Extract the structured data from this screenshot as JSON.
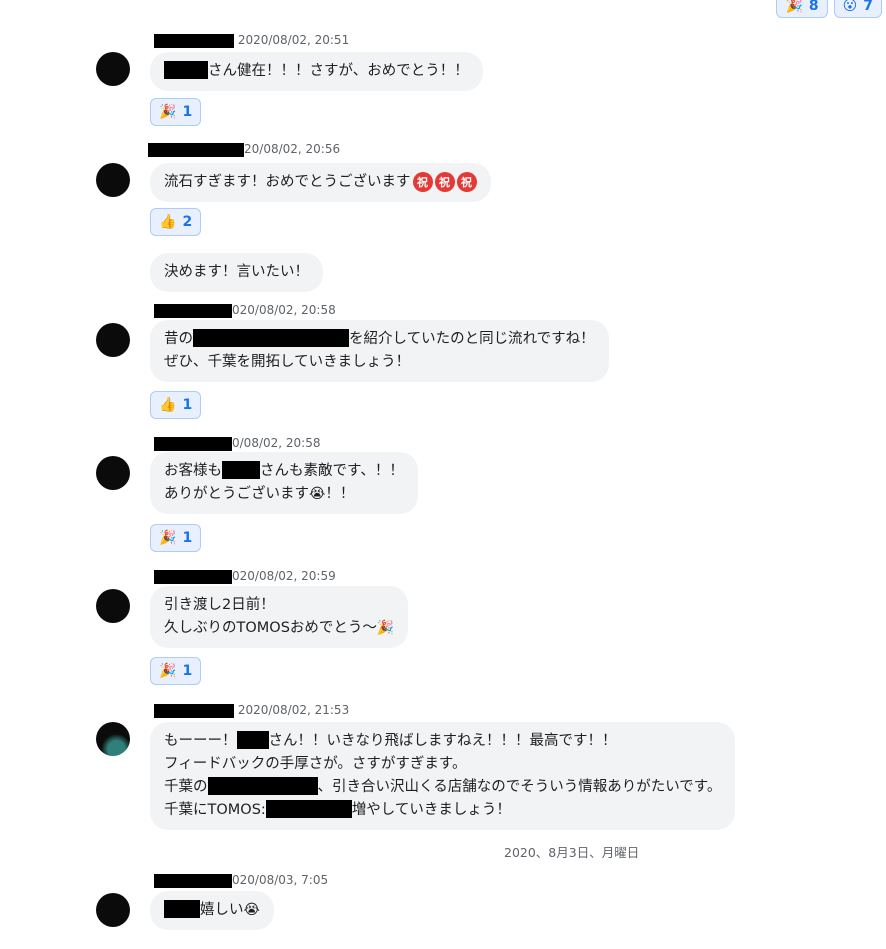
{
  "top_reactions": [
    {
      "emoji": "🎉",
      "count": "8"
    },
    {
      "emoji": "😮",
      "count": "7"
    }
  ],
  "messages": [
    {
      "timestamp": "2020/08/02, 20:51",
      "lines": [
        "さん健在！！！さすが、おめでとう！！"
      ],
      "reaction": {
        "emoji": "🎉",
        "count": "1"
      }
    },
    {
      "timestamp": "20/08/02, 20:56",
      "lines": [
        "流石すぎます！おめでとうございます"
      ],
      "badge": "祝",
      "reaction": {
        "emoji": "👍",
        "count": "2"
      },
      "followup": "決めます！言いたい！"
    },
    {
      "timestamp": "020/08/02, 20:58",
      "lines": [
        "昔の",
        "を紹介していたのと同じ流れですね！",
        "ぜひ、千葉を開拓していきましょう！"
      ],
      "reaction": {
        "emoji": "👍",
        "count": "1"
      }
    },
    {
      "timestamp": "0/08/02, 20:58",
      "lines": [
        "お客様も",
        "さんも素敵です、！！",
        "ありがとうございます",
        "！！"
      ],
      "reaction": {
        "emoji": "🎉",
        "count": "1"
      }
    },
    {
      "timestamp": "020/08/02, 20:59",
      "lines": [
        "引き渡し2日前！",
        "久しぶりのTOMOSおめでとう〜"
      ],
      "reaction": {
        "emoji": "🎉",
        "count": "1"
      }
    },
    {
      "timestamp": "2020/08/02, 21:53",
      "lines": [
        "もーーー！",
        "さん！！いきなり飛ばしますねえ！！！最高です！！",
        "フィードバックの手厚さが。さすがすぎます。",
        "千葉の",
        "、引き合い沢山くる店舗なのでそういう情報ありがたいです。",
        "千葉にTOMOS:",
        "増やしていきましょう！"
      ]
    },
    {
      "timestamp": "020/08/03, 7:05",
      "lines": [
        "嬉しい"
      ]
    }
  ],
  "date_separator": "2020、8月3日、月曜日",
  "emoji": {
    "party": "🎉",
    "crying": "😭"
  }
}
